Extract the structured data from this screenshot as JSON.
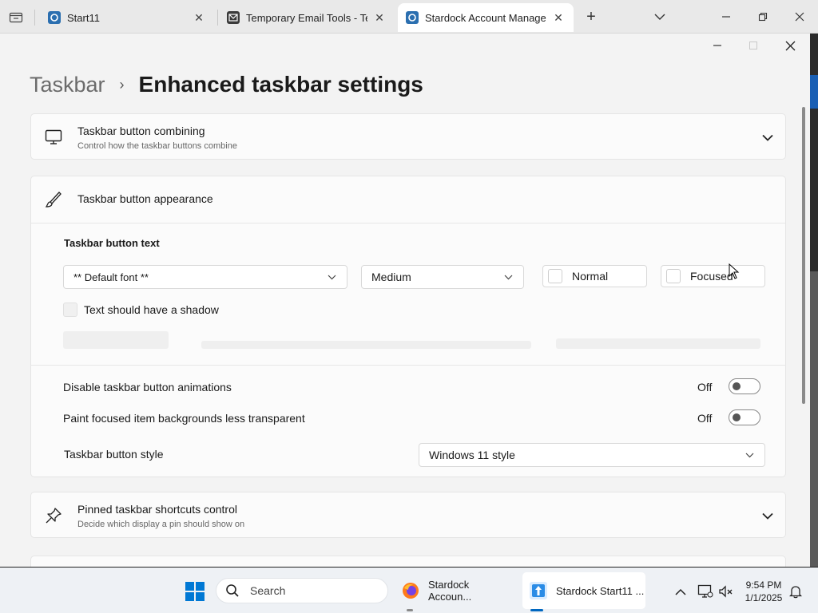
{
  "browser": {
    "tabs": [
      {
        "title": "Start11",
        "active": false
      },
      {
        "title": "Temporary Email Tools - Temporary Email Tools",
        "active": false
      },
      {
        "title": "Stardock Account Management",
        "active": true
      }
    ],
    "new_tab_symbol": "+"
  },
  "app": {
    "breadcrumb": {
      "parent": "Taskbar",
      "separator": "›",
      "current": "Enhanced taskbar settings"
    },
    "combining": {
      "title": "Taskbar button combining",
      "subtitle": "Control how the taskbar buttons combine"
    },
    "appearance": {
      "title": "Taskbar button appearance",
      "text_section_label": "Taskbar button text",
      "font_select": "** Default font **",
      "size_select": "Medium",
      "normal_label": "Normal",
      "focused_label": "Focused",
      "shadow_label": "Text should have a shadow"
    },
    "animations": {
      "label": "Disable taskbar button animations",
      "state": "Off"
    },
    "paint_focused": {
      "label": "Paint focused item backgrounds less transparent",
      "state": "Off"
    },
    "button_style": {
      "label": "Taskbar button style",
      "value": "Windows 11 style"
    },
    "pinned": {
      "title": "Pinned taskbar shortcuts control",
      "subtitle": "Decide which display a pin should show on"
    }
  },
  "taskbar": {
    "search_placeholder": "Search",
    "apps": [
      {
        "label": "Stardock Accoun..."
      },
      {
        "label": "Stardock Start11 ..."
      }
    ],
    "clock": {
      "time": "9:54 PM",
      "date": "1/1/2025"
    }
  },
  "colors": {
    "accent": "#0067c0",
    "toggle_off_knob": "#555555"
  }
}
